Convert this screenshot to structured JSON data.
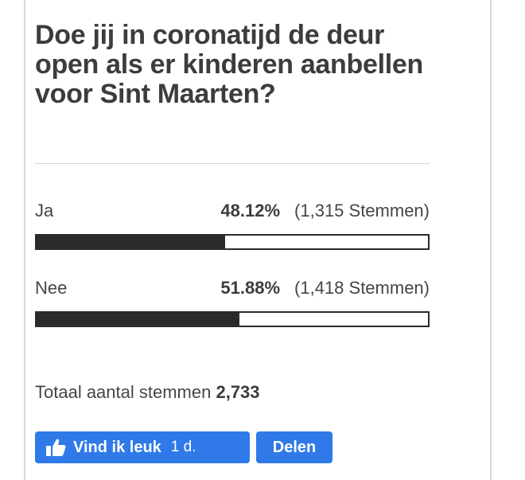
{
  "poll": {
    "question": "Doe jij in coronatijd de deur open als er kinderen aanbellen voor Sint Maarten?",
    "options": [
      {
        "label": "Ja",
        "percent_text": "48.12%",
        "votes_text": "(1,315 Stemmen)",
        "percent": 48.12
      },
      {
        "label": "Nee",
        "percent_text": "51.88%",
        "votes_text": "(1,418 Stemmen)",
        "percent": 51.88
      }
    ],
    "total_label": "Totaal aantal stemmen",
    "total_value": "2,733"
  },
  "actions": {
    "like_label": "Vind ik leuk",
    "like_time": "1 d.",
    "share_label": "Delen"
  },
  "icons": {
    "like": "thumbs-up-icon"
  },
  "colors": {
    "button": "#2f7ae8",
    "bar": "#2b2b2b"
  }
}
